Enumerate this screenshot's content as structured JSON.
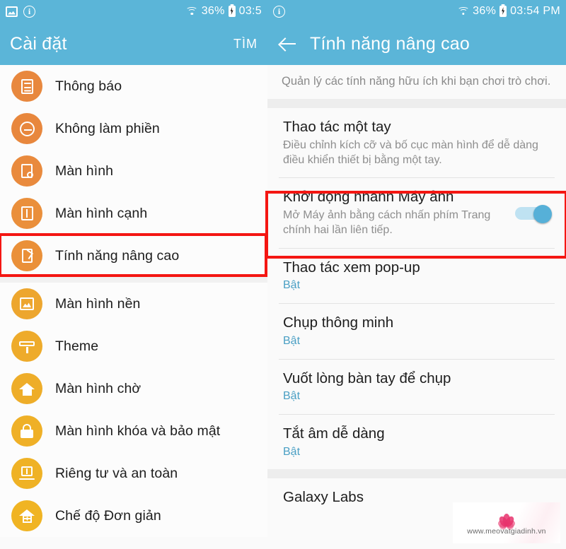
{
  "status_bar": {
    "left_icons": [
      "photo-icon",
      "info-icon"
    ],
    "battery_percent": "36%",
    "time_left": "03:5",
    "time_right": "03:54 PM",
    "wifi_icon": "wifi-icon",
    "battery_icon": "battery-charging-icon",
    "info_icon": "info-icon"
  },
  "colors": {
    "accent_blue": "#5bb5d8",
    "highlight_red": "#f41612",
    "link_blue": "#4a9fc4",
    "icon_orange": "#e8883e",
    "icon_amber": "#eeab2b"
  },
  "left_panel": {
    "header": {
      "title": "Cài đặt",
      "action": "TÌM"
    },
    "items": [
      {
        "label": "Thông báo",
        "icon": "notification-icon",
        "color": "#e8883e"
      },
      {
        "label": "Không làm phiền",
        "icon": "do-not-disturb-icon",
        "color": "#e8873d"
      },
      {
        "label": "Màn hình",
        "icon": "display-icon",
        "color": "#e98a3d"
      },
      {
        "label": "Màn hình cạnh",
        "icon": "edge-screen-icon",
        "color": "#ea8f3b"
      },
      {
        "label": "Tính năng nâng cao",
        "icon": "advanced-features-icon",
        "color": "#ea9039",
        "highlighted": true
      },
      {
        "label": "Màn hình nền",
        "icon": "wallpaper-icon",
        "color": "#eda62e"
      },
      {
        "label": "Theme",
        "icon": "theme-icon",
        "color": "#eeab2b"
      },
      {
        "label": "Màn hình chờ",
        "icon": "home-screen-icon",
        "color": "#eead29"
      },
      {
        "label": "Màn hình khóa và bảo mật",
        "icon": "lock-icon",
        "color": "#efb027"
      },
      {
        "label": "Riêng tư và an toàn",
        "icon": "privacy-icon",
        "color": "#efb225"
      },
      {
        "label": "Chế độ Đơn giản",
        "icon": "simple-mode-icon",
        "color": "#f0b423"
      }
    ]
  },
  "right_panel": {
    "header": {
      "title": "Tính năng nâng cao",
      "back_icon": "back-arrow-icon"
    },
    "top_description": "Quản lý các tính năng hữu ích khi bạn chơi trò chơi.",
    "items": [
      {
        "title": "Thao tác một tay",
        "subtitle": "Điều chỉnh kích cỡ và bố cục màn hình để dễ dàng điều khiển thiết bị bằng một tay.",
        "subtitle_is_status": false,
        "toggle": null,
        "highlighted": false
      },
      {
        "title": "Khởi động nhanh Máy ảnh",
        "subtitle": "Mở Máy ảnh bằng cách nhấn phím Trang chính hai lần liên tiếp.",
        "subtitle_is_status": false,
        "toggle": "on",
        "highlighted": true
      },
      {
        "title": "Thao tác xem pop-up",
        "subtitle": "Bật",
        "subtitle_is_status": true,
        "toggle": null,
        "highlighted": false
      },
      {
        "title": "Chụp thông minh",
        "subtitle": "Bật",
        "subtitle_is_status": true,
        "toggle": null,
        "highlighted": false
      },
      {
        "title": "Vuốt lòng bàn tay để chụp",
        "subtitle": "Bật",
        "subtitle_is_status": true,
        "toggle": null,
        "highlighted": false
      },
      {
        "title": "Tắt âm dễ dàng",
        "subtitle": "Bật",
        "subtitle_is_status": true,
        "toggle": null,
        "highlighted": false
      },
      {
        "title": "Galaxy Labs",
        "subtitle": "",
        "subtitle_is_status": false,
        "toggle": null,
        "highlighted": false
      }
    ]
  },
  "watermark": {
    "url": "www.meovatgiadinh.vn",
    "logo": "lotus-icon"
  }
}
